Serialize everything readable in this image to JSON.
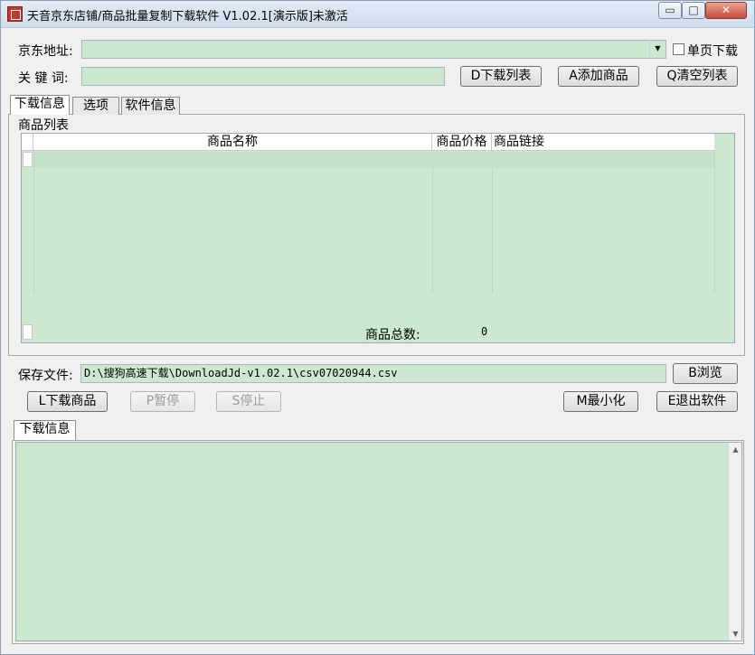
{
  "window": {
    "title": "天音京东店铺/商品批量复制下载软件 V1.02.1[演示版]未激活",
    "min_glyph": "▭",
    "max_glyph": "□",
    "close_glyph": "✕"
  },
  "address": {
    "label": "京东地址:",
    "value": "",
    "single_page_label": "单页下载",
    "single_page_checked": false
  },
  "keyword": {
    "label": "关 键 词:",
    "value": ""
  },
  "buttons": {
    "download_list": "D下载列表",
    "add_product": "A添加商品",
    "clear_list": "Q清空列表",
    "browse": "B浏览",
    "download_products": "L下载商品",
    "pause": "P暂停",
    "stop": "S停止",
    "minimize": "M最小化",
    "exit": "E退出软件"
  },
  "tabs": [
    {
      "label": "下载信息",
      "active": true
    },
    {
      "label": "选项",
      "active": false
    },
    {
      "label": "软件信息",
      "active": false
    }
  ],
  "product_list": {
    "group_label": "商品列表",
    "columns": [
      "商品名称",
      "商品价格",
      "商品链接"
    ],
    "rows": [],
    "total_label": "商品总数:",
    "total_value": "0"
  },
  "save_file": {
    "label": "保存文件:",
    "value": "D:\\搜狗高速下载\\DownloadJd-v1.02.1\\csv07020944.csv"
  },
  "log": {
    "tab_label": "下载信息",
    "content": ""
  },
  "colors": {
    "field_bg": "#cce8cf",
    "title_bar": "#dbe6f3",
    "close_button": "#c8493a"
  }
}
